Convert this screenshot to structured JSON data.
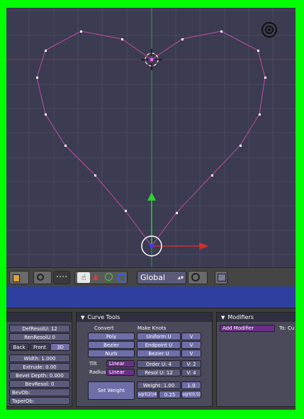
{
  "header": {
    "orientation_label": "Global"
  },
  "panels": {
    "curve_left": {
      "defresolu_label": "DefResolU: 12",
      "renresolu_label": "RenResolU 0",
      "back_label": "Back",
      "front_label": "Front",
      "threed_label": "3D",
      "width_label": "Width: 1.000",
      "extrude_label": "Extrude: 0.00",
      "bevel_depth_label": "Bevel Depth: 0.000",
      "bevresol_label": "BevResol: 0",
      "bevob_label": "BevOb:",
      "taperob_label": "TaperOb:"
    },
    "curve_tools": {
      "title": "Curve Tools",
      "convert_label": "Convert",
      "poly_label": "Poly",
      "bezier_label": "Bezier",
      "nurb_label": "Nurb",
      "make_knots_label": "Make Knots",
      "uniform_u_label": "Uniform U",
      "uniform_v_label": "V",
      "endpoint_u_label": "Endpoint U",
      "endpoint_v_label": "V",
      "bezier_u_label": "Bezier U",
      "bezier_v_label": "V",
      "tilt_label": "Tilt",
      "tilt_value": "Linear",
      "radius_label": "Radius",
      "radius_value": "Linear",
      "order_u_label": "Order U: 4",
      "order_v_label": "V: 2",
      "resol_u_label": "Resol U: 12",
      "resol_v_label": "V: 4",
      "set_weight_label": "Set Weight",
      "weight_label": "Weight: 1.00",
      "weight_one_label": "1.0",
      "sqrt2_label": "sqrt(2)/4",
      "quarter_label": "0.25",
      "sqrt05_label": "sqrt(0.5)"
    },
    "modifiers": {
      "title": "Modifiers",
      "add_modifier_label": "Add Modifier",
      "to_label": "To: Cu"
    }
  }
}
